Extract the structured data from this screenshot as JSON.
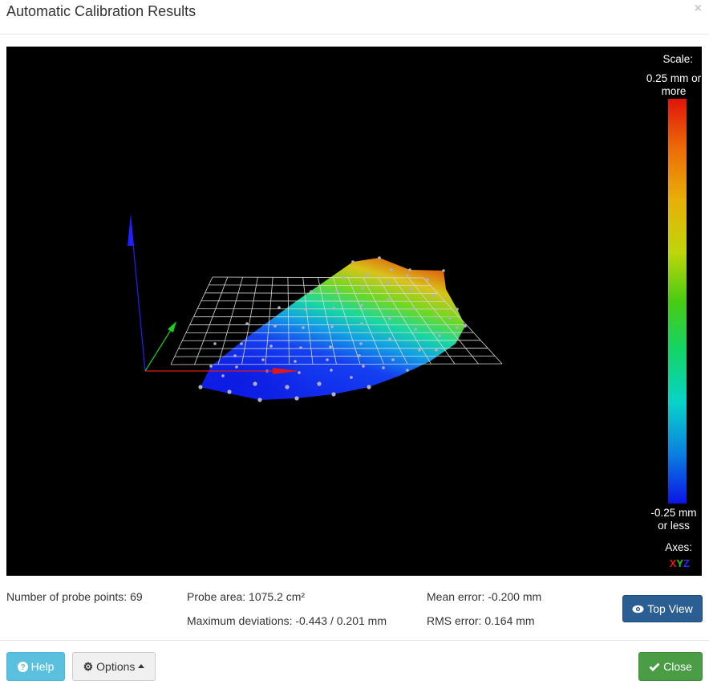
{
  "dialog": {
    "title": "Automatic Calibration Results",
    "close_x": "×"
  },
  "viewer": {
    "scale_title": "Scale:",
    "scale_max": "0.25 mm or more",
    "scale_min": "-0.25 mm or less",
    "axes_label": "Axes:",
    "axes": [
      {
        "letter": "X",
        "color": "#e8141e"
      },
      {
        "letter": "Y",
        "color": "#1ecc1e"
      },
      {
        "letter": "Z",
        "color": "#2a2aff"
      }
    ],
    "scale_colors": [
      "#e0140a",
      "#e8b008",
      "#48cc12",
      "#08d4c8",
      "#0a14e6"
    ]
  },
  "stats": {
    "probe_points": "Number of probe points: 69",
    "probe_area": "Probe area: 1075.2 cm²",
    "max_deviations": "Maximum deviations: -0.443 / 0.201 mm",
    "mean_error": "Mean error: -0.200 mm",
    "rms_error": "RMS error: 0.164 mm"
  },
  "buttons": {
    "top_view": "Top View",
    "help": "Help",
    "options": "Options",
    "close": "Close"
  }
}
